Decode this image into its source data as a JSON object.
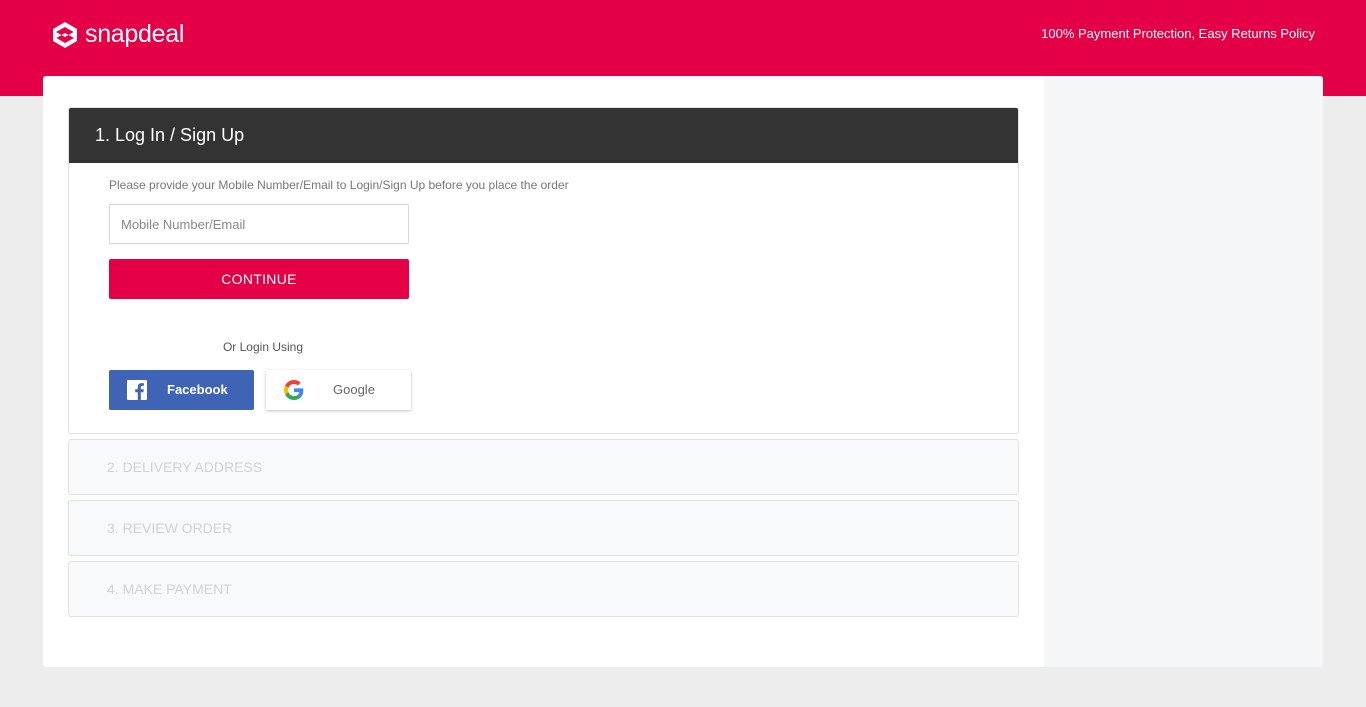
{
  "header": {
    "brand": "snapdeal",
    "policy": "100% Payment Protection, Easy Returns Policy",
    "logo_icon": "snapdeal-logo-icon",
    "colors": {
      "brand": "#e40046",
      "dark": "#333333",
      "facebook": "#3f63b5"
    }
  },
  "login": {
    "title": "1. Log In / Sign Up",
    "prompt": "Please provide your Mobile Number/Email to Login/Sign Up before you place the order",
    "input_value": "",
    "input_placeholder": "Mobile Number/Email",
    "continue_label": "CONTINUE",
    "or_text": "Or Login Using",
    "facebook_label": "Facebook",
    "google_label": "Google"
  },
  "steps": [
    {
      "label": "2. DELIVERY ADDRESS"
    },
    {
      "label": "3. REVIEW ORDER"
    },
    {
      "label": "4. MAKE PAYMENT"
    }
  ]
}
